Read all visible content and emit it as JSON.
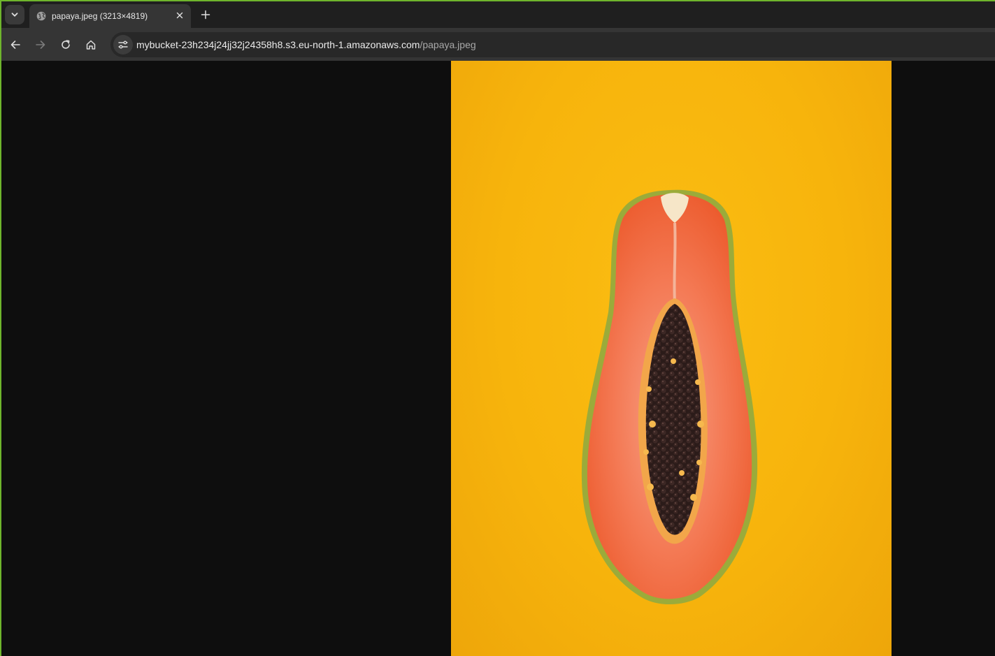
{
  "tab": {
    "title": "papaya.jpeg (3213×4819)",
    "favicon": "globe-icon",
    "close_icon": "close-icon"
  },
  "tabstrip": {
    "search_icon": "chevron-down-icon",
    "new_tab_icon": "plus-icon"
  },
  "toolbar": {
    "back_icon": "arrow-left-icon",
    "forward_icon": "arrow-right-icon",
    "reload_icon": "reload-icon",
    "home_icon": "home-icon",
    "site_info_icon": "tune-icon"
  },
  "address_bar": {
    "host": "mybucket-23h234j24jj32j24358h8.s3.eu-north-1.amazonaws.com",
    "path": "/papaya.jpeg"
  },
  "image": {
    "subject": "papaya-image",
    "colors": {
      "background": "#f7b40c",
      "flesh": "#f2663a",
      "seeds": "#2f1e1c"
    }
  },
  "colors": {
    "window_border": "#6fb52c",
    "tabstrip_bg": "#1f1f1f",
    "toolbar_bg": "#353535",
    "page_bg": "#0e0e0e"
  }
}
